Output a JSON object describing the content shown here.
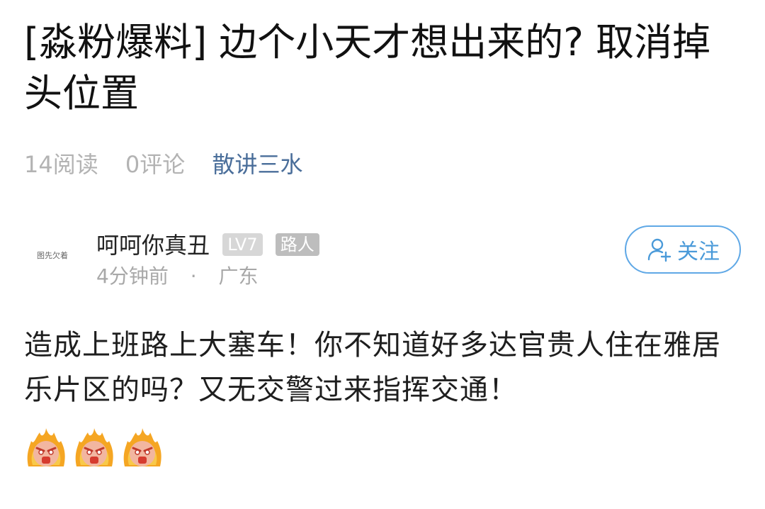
{
  "post": {
    "title": "[淼粉爆料] 边个小天才想出来的? 取消掉头位置",
    "read_count": "14阅读",
    "comment_count": "0评论",
    "board_name": "散讲三水"
  },
  "author": {
    "avatar_text": "图先欠着",
    "name": "呵呵你真丑",
    "level": "LV7",
    "role": "路人",
    "time": "4分钟前",
    "separator": "·",
    "location": "广东",
    "follow_label": "关注"
  },
  "content": {
    "text": "造成上班路上大塞车！你不知道好多达官贵人住在雅居乐片区的吗？又无交警过来指挥交通！",
    "emoji_names": [
      "angry-fire-emoji",
      "angry-fire-emoji",
      "angry-fire-emoji"
    ]
  },
  "colors": {
    "accent": "#4a9ad9",
    "board_link": "#4a6e9a",
    "muted": "#b3b3b3"
  }
}
